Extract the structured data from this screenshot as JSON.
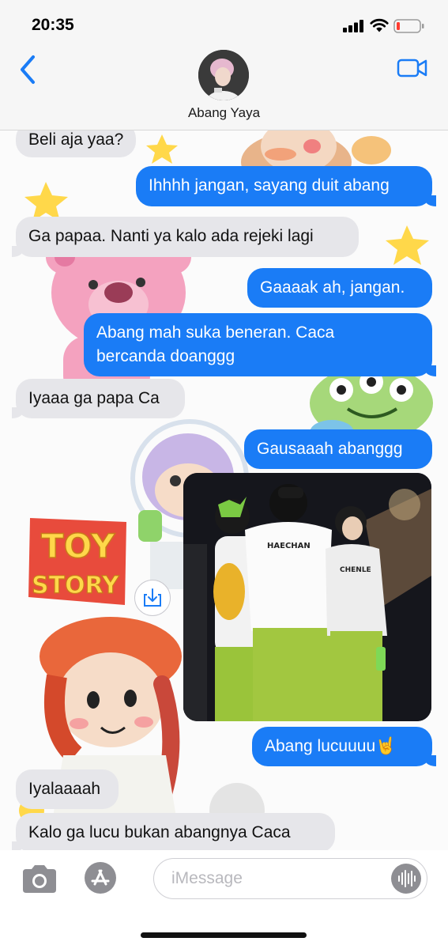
{
  "status_bar": {
    "time": "20:35"
  },
  "header": {
    "contact_name": "Abang Yaya"
  },
  "messages": [
    {
      "sender": "in",
      "text": "Beli aja yaa?"
    },
    {
      "sender": "out",
      "text": "Ihhhh jangan, sayang duit abang"
    },
    {
      "sender": "in",
      "text": "Ga papaa. Nanti ya kalo ada rejeki lagi"
    },
    {
      "sender": "out",
      "text": "Gaaaak ah, jangan."
    },
    {
      "sender": "out",
      "text": "Abang mah suka beneran. Caca",
      "text2": "bercanda doanggg"
    },
    {
      "sender": "in",
      "text": "Iyaaa ga papa Ca"
    },
    {
      "sender": "out",
      "text": "Gausaaah abanggg"
    },
    {
      "sender": "out",
      "type": "photo"
    },
    {
      "sender": "out",
      "text": "Abang lucuuuu🤘"
    },
    {
      "sender": "in",
      "text": "Iyalaaaah"
    },
    {
      "sender": "in",
      "text": "Kalo ga lucu bukan abangnya Caca"
    }
  ],
  "photo": {
    "shirt_labels": [
      "HAECHAN",
      "CHENLE"
    ]
  },
  "wallpaper": {
    "logo_line1": "TOY",
    "logo_line2": "STORY"
  },
  "input": {
    "placeholder": "iMessage"
  },
  "colors": {
    "outgoing_bubble": "#1a7cf6",
    "incoming_bubble": "#e6e6ea",
    "accent": "#1a7cf6"
  },
  "icons": [
    "back-chevron-icon",
    "video-call-icon",
    "camera-icon",
    "app-store-icon",
    "audio-waveform-icon",
    "save-photo-icon"
  ]
}
